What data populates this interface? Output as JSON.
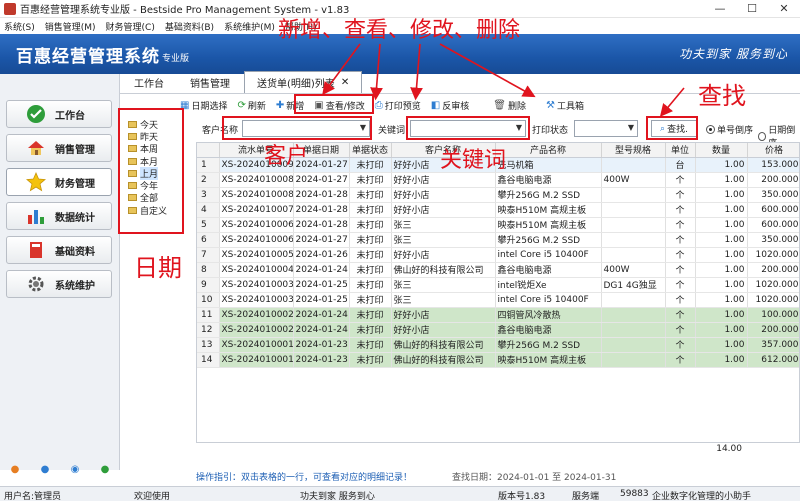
{
  "window": {
    "title": "百惠经营管理系统专业版 - Bestside Pro Management System - v1.83",
    "minimize": "—",
    "maximize": "☐",
    "close": "✕"
  },
  "menu": [
    "系统(S)",
    "销售管理(M)",
    "财务管理(C)",
    "基础资料(B)",
    "系统维护(M)",
    "帮助(H)"
  ],
  "banner": {
    "app_name": "百惠经营管理系统",
    "edition": "专业版",
    "slogan": "功夫到家 服务到心"
  },
  "nav": [
    {
      "label": "工作台",
      "icon": "check-circle-icon"
    },
    {
      "label": "销售管理",
      "icon": "house-icon"
    },
    {
      "label": "财务管理",
      "icon": "star-icon"
    },
    {
      "label": "数据统计",
      "icon": "bar-chart-icon"
    },
    {
      "label": "基础资料",
      "icon": "book-icon"
    },
    {
      "label": "系统维护",
      "icon": "gear-icon"
    }
  ],
  "tabs": [
    {
      "label": "工作台"
    },
    {
      "label": "销售管理"
    },
    {
      "label": "送货单(明细)列表",
      "close": "✕"
    }
  ],
  "toolbar": [
    {
      "label": "日期选择",
      "icon": "calendar-icon"
    },
    {
      "label": "刷新",
      "icon": "refresh-icon"
    },
    {
      "label": "新增",
      "icon": "plus-icon"
    },
    {
      "label": "查看/修改",
      "icon": "edit-icon"
    },
    {
      "label": "打印预览",
      "icon": "print-preview-icon"
    },
    {
      "label": "反审核",
      "icon": "unapprove-icon"
    },
    {
      "label": "删除",
      "icon": "trash-icon"
    },
    {
      "label": "工具箱",
      "icon": "toolbox-icon"
    }
  ],
  "filters": {
    "customer_label": "客户名称",
    "keyword_label": "关键词",
    "print_status_label": "打印状态",
    "find_label": "查找.",
    "radio_desc": "单号倒序",
    "radio_asc": "日期倒序"
  },
  "date_tree": [
    "今天",
    "昨天",
    "本周",
    "本月",
    "上月",
    "今年",
    "全部",
    "自定义"
  ],
  "grid": {
    "columns": [
      "",
      "流水单号",
      "单据日期",
      "单据状态",
      "客户名称",
      "产品名称",
      "型号规格",
      "单位",
      "数量",
      "价格"
    ],
    "rows": [
      [
        "1",
        "XS-2024010009",
        "2024-01-27",
        "未打印",
        "好好小店",
        "先马机箱",
        "",
        "台",
        "1.00",
        "153.000"
      ],
      [
        "2",
        "XS-2024010008",
        "2024-01-27",
        "未打印",
        "好好小店",
        "鑫谷电脑电源",
        "400W",
        "个",
        "1.00",
        "200.000"
      ],
      [
        "3",
        "XS-2024010008",
        "2024-01-28",
        "未打印",
        "好好小店",
        "攀升256G M.2 SSD",
        "",
        "个",
        "1.00",
        "350.000"
      ],
      [
        "4",
        "XS-2024010007",
        "2024-01-28",
        "未打印",
        "好好小店",
        "映泰H510M 高规主板",
        "",
        "个",
        "1.00",
        "600.000"
      ],
      [
        "5",
        "XS-2024010006",
        "2024-01-28",
        "未打印",
        "张三",
        "映泰H510M 高规主板",
        "",
        "个",
        "1.00",
        "600.000"
      ],
      [
        "6",
        "XS-2024010006",
        "2024-01-27",
        "未打印",
        "张三",
        "攀升256G M.2 SSD",
        "",
        "个",
        "1.00",
        "350.000"
      ],
      [
        "7",
        "XS-2024010005",
        "2024-01-26",
        "未打印",
        "好好小店",
        "intel Core i5 10400F",
        "",
        "个",
        "1.00",
        "1020.000"
      ],
      [
        "8",
        "XS-2024010004",
        "2024-01-24",
        "未打印",
        "佛山好的科技有限公司",
        "鑫谷电脑电源",
        "400W",
        "个",
        "1.00",
        "200.000"
      ],
      [
        "9",
        "XS-2024010003",
        "2024-01-25",
        "未打印",
        "张三",
        "intel锐炬Xe",
        "DG1 4G独显",
        "个",
        "1.00",
        "1020.000"
      ],
      [
        "10",
        "XS-2024010003",
        "2024-01-25",
        "未打印",
        "张三",
        "intel Core i5 10400F",
        "",
        "个",
        "1.00",
        "1020.000"
      ],
      [
        "11",
        "XS-2024010002",
        "2024-01-24",
        "未打印",
        "好好小店",
        "四铜管风冷散热",
        "",
        "个",
        "1.00",
        "100.000"
      ],
      [
        "12",
        "XS-2024010002",
        "2024-01-24",
        "未打印",
        "好好小店",
        "鑫谷电脑电源",
        "",
        "个",
        "1.00",
        "200.000"
      ],
      [
        "13",
        "XS-2024010001",
        "2024-01-23",
        "未打印",
        "佛山好的科技有限公司",
        "攀升256G M.2 SSD",
        "",
        "个",
        "1.00",
        "357.000"
      ],
      [
        "14",
        "XS-2024010001",
        "2024-01-23",
        "未打印",
        "佛山好的科技有限公司",
        "映泰H510M 高规主板",
        "",
        "个",
        "1.00",
        "612.000"
      ]
    ],
    "total_qty": "14.00"
  },
  "hint": {
    "text": "操作指引：双击表格的一行，可查看对应的明细记录！",
    "query_date": "查找日期：2024-01-01 至 2024-01-31"
  },
  "status": {
    "user": "用户名:管理员",
    "welcome": "欢迎使用",
    "motto": "功夫到家 服务到心",
    "version": "版本号1.83",
    "server": "服务端",
    "code": "59883",
    "assistant": "企业数字化管理的小助手"
  },
  "annotations": {
    "top": "新增、查看、修改、删除",
    "find": "查找",
    "customer": "客户",
    "keyword": "关键词",
    "date": "日期"
  },
  "colors": {
    "banner": "#1b56a8",
    "annotation": "#e0141e",
    "highlight_row": "#cfe6c9",
    "hint": "#1d5fb4"
  }
}
